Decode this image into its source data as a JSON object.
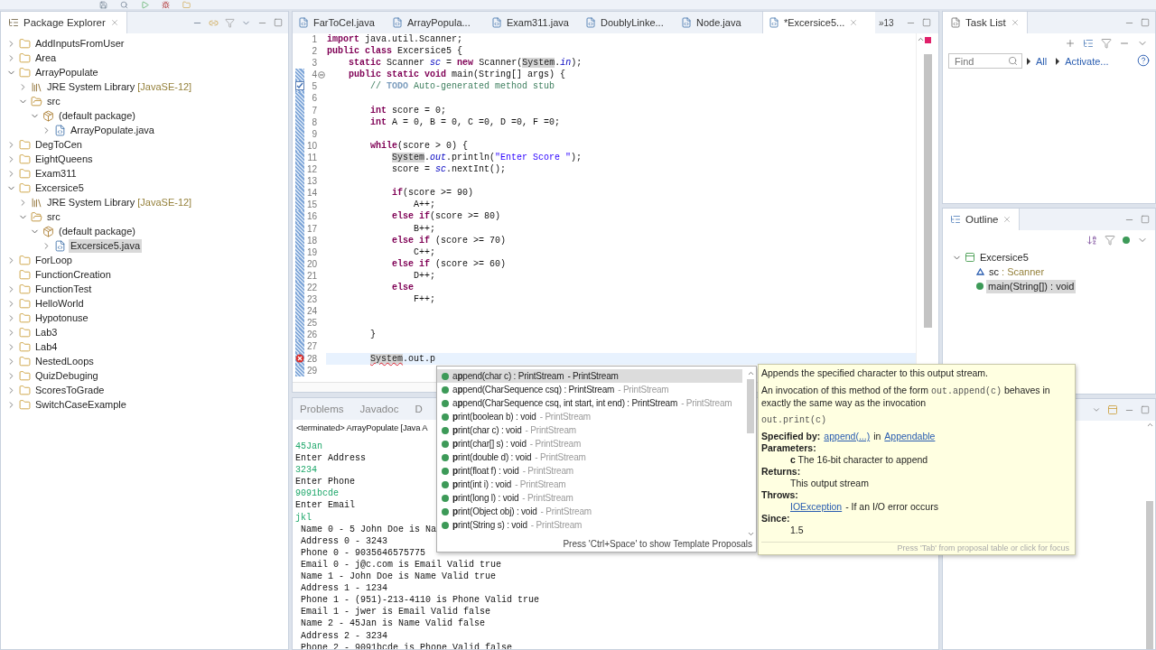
{
  "package_explorer": {
    "title": "Package Explorer",
    "items": [
      {
        "label": "AddInputsFromUser",
        "kind": "project",
        "expanded": false,
        "selected": false
      },
      {
        "label": "Area",
        "kind": "project",
        "expanded": false,
        "selected": false
      },
      {
        "label": "ArrayPopulate",
        "kind": "project",
        "expanded": true,
        "selected": false,
        "children": [
          {
            "label": "JRE System Library",
            "decoration": "[JavaSE-12]",
            "kind": "library",
            "expanded": false,
            "selected": false
          },
          {
            "label": "src",
            "kind": "src",
            "expanded": true,
            "selected": false,
            "children": [
              {
                "label": "(default package)",
                "kind": "package",
                "expanded": true,
                "selected": false,
                "children": [
                  {
                    "label": "ArrayPopulate.java",
                    "kind": "file",
                    "expanded": false,
                    "selected": false
                  }
                ]
              }
            ]
          }
        ]
      },
      {
        "label": "DegToCen",
        "kind": "project",
        "expanded": false,
        "selected": false
      },
      {
        "label": "EightQueens",
        "kind": "project",
        "expanded": false,
        "selected": false
      },
      {
        "label": "Exam311",
        "kind": "project",
        "expanded": false,
        "selected": false
      },
      {
        "label": "Excersice5",
        "kind": "project",
        "expanded": true,
        "selected": false,
        "children": [
          {
            "label": "JRE System Library",
            "decoration": "[JavaSE-12]",
            "kind": "library",
            "expanded": false,
            "selected": false
          },
          {
            "label": "src",
            "kind": "src",
            "expanded": true,
            "selected": false,
            "children": [
              {
                "label": "(default package)",
                "kind": "package",
                "expanded": true,
                "selected": false,
                "children": [
                  {
                    "label": "Excersice5.java",
                    "kind": "file",
                    "expanded": false,
                    "selected": true
                  }
                ]
              }
            ]
          }
        ]
      },
      {
        "label": "ForLoop",
        "kind": "project",
        "expanded": false,
        "selected": false
      },
      {
        "label": "FunctionCreation",
        "kind": "project",
        "selected": false
      },
      {
        "label": "FunctionTest",
        "kind": "project",
        "expanded": false,
        "selected": false
      },
      {
        "label": "HelloWorld",
        "kind": "project",
        "expanded": false,
        "selected": false
      },
      {
        "label": "Hypotonuse",
        "kind": "project",
        "expanded": false,
        "selected": false
      },
      {
        "label": "Lab3",
        "kind": "project",
        "expanded": false,
        "selected": false
      },
      {
        "label": "Lab4",
        "kind": "project",
        "expanded": false,
        "selected": false
      },
      {
        "label": "NestedLoops",
        "kind": "project",
        "expanded": false,
        "selected": false
      },
      {
        "label": "QuizDebuging",
        "kind": "project",
        "expanded": false,
        "selected": false
      },
      {
        "label": "ScoresToGrade",
        "kind": "project",
        "expanded": false,
        "selected": false
      },
      {
        "label": "SwitchCaseExample",
        "kind": "project",
        "expanded": false,
        "selected": false
      }
    ]
  },
  "editor_tabs": [
    {
      "label": "FarToCel.java",
      "selected": false
    },
    {
      "label": "ArrayPopula...",
      "selected": false
    },
    {
      "label": "Exam311.java",
      "selected": false
    },
    {
      "label": "DoublyLinke...",
      "selected": false
    },
    {
      "label": "Node.java",
      "selected": false
    },
    {
      "label": "*Excersice5...",
      "selected": true
    }
  ],
  "editor_overflow": "»13",
  "code_lines": [
    {
      "number": "1",
      "changed": false,
      "current": false,
      "segments": [
        {
          "text": "import",
          "kind": "keyword"
        },
        {
          "text": " java.util.Scanner;",
          "kind": "plain"
        }
      ]
    },
    {
      "number": "2",
      "changed": false,
      "current": false,
      "segments": [
        {
          "text": "public class",
          "kind": "keyword"
        },
        {
          "text": " Excersice5 {",
          "kind": "plain"
        }
      ]
    },
    {
      "number": "3",
      "changed": false,
      "current": false,
      "segments": [
        {
          "text": "    static",
          "kind": "keyword"
        },
        {
          "text": " Scanner ",
          "kind": "plain"
        },
        {
          "text": "sc",
          "kind": "field"
        },
        {
          "text": " = ",
          "kind": "plain"
        },
        {
          "text": "new",
          "kind": "keyword"
        },
        {
          "text": " Scanner(",
          "kind": "plain"
        },
        {
          "text": "System",
          "kind": "occurrence"
        },
        {
          "text": ".",
          "kind": "plain"
        },
        {
          "text": "in",
          "kind": "field"
        },
        {
          "text": ");",
          "kind": "plain"
        }
      ]
    },
    {
      "number": "4",
      "changed": true,
      "current": false,
      "fold": true,
      "segments": [
        {
          "text": "    public static void",
          "kind": "keyword"
        },
        {
          "text": " main(String[] args) {",
          "kind": "plain"
        }
      ]
    },
    {
      "number": "5",
      "changed": true,
      "current": false,
      "kind": "task",
      "segments": [
        {
          "text": "        // ",
          "kind": "comment"
        },
        {
          "text": "TODO",
          "kind": "todo"
        },
        {
          "text": " Auto-generated method stub",
          "kind": "comment"
        }
      ]
    },
    {
      "number": "6",
      "changed": true,
      "current": false
    },
    {
      "number": "7",
      "changed": true,
      "current": false,
      "segments": [
        {
          "text": "        int",
          "kind": "keyword"
        },
        {
          "text": " score = 0;",
          "kind": "plain"
        }
      ]
    },
    {
      "number": "8",
      "changed": true,
      "current": false,
      "segments": [
        {
          "text": "        int",
          "kind": "keyword"
        },
        {
          "text": " A = 0, B = 0, C =0, D =0, F =0;",
          "kind": "plain"
        }
      ]
    },
    {
      "number": "9",
      "changed": true,
      "current": false
    },
    {
      "number": "10",
      "changed": true,
      "current": false,
      "segments": [
        {
          "text": "        while",
          "kind": "keyword"
        },
        {
          "text": "(score > 0) {",
          "kind": "plain"
        }
      ]
    },
    {
      "number": "11",
      "changed": true,
      "current": false,
      "segments": [
        {
          "text": "            System",
          "kind": "occurrence"
        },
        {
          "text": ".",
          "kind": "plain"
        },
        {
          "text": "out",
          "kind": "field"
        },
        {
          "text": ".println(",
          "kind": "plain"
        },
        {
          "text": "\"Enter Score \"",
          "kind": "string"
        },
        {
          "text": ");",
          "kind": "plain"
        }
      ]
    },
    {
      "number": "12",
      "changed": true,
      "current": false,
      "segments": [
        {
          "text": "            score = ",
          "kind": "plain"
        },
        {
          "text": "sc",
          "kind": "field"
        },
        {
          "text": ".nextInt();",
          "kind": "plain"
        }
      ]
    },
    {
      "number": "13",
      "changed": true,
      "current": false
    },
    {
      "number": "14",
      "changed": true,
      "current": false,
      "segments": [
        {
          "text": "            if",
          "kind": "keyword"
        },
        {
          "text": "(score >= 90)",
          "kind": "plain"
        }
      ]
    },
    {
      "number": "15",
      "changed": true,
      "current": false,
      "segments": [
        {
          "text": "                A++;",
          "kind": "plain"
        }
      ]
    },
    {
      "number": "16",
      "changed": true,
      "current": false,
      "segments": [
        {
          "text": "            else if",
          "kind": "keyword"
        },
        {
          "text": "(score >= 80)",
          "kind": "plain"
        }
      ]
    },
    {
      "number": "17",
      "changed": true,
      "current": false,
      "segments": [
        {
          "text": "                B++;",
          "kind": "plain"
        }
      ]
    },
    {
      "number": "18",
      "changed": true,
      "current": false,
      "segments": [
        {
          "text": "            else if",
          "kind": "keyword"
        },
        {
          "text": " (score >= 70)",
          "kind": "plain"
        }
      ]
    },
    {
      "number": "19",
      "changed": true,
      "current": false,
      "segments": [
        {
          "text": "                C++;",
          "kind": "plain"
        }
      ]
    },
    {
      "number": "20",
      "changed": true,
      "current": false,
      "segments": [
        {
          "text": "            else if",
          "kind": "keyword"
        },
        {
          "text": " (score >= 60)",
          "kind": "plain"
        }
      ]
    },
    {
      "number": "21",
      "changed": true,
      "current": false,
      "segments": [
        {
          "text": "                D++;",
          "kind": "plain"
        }
      ]
    },
    {
      "number": "22",
      "changed": true,
      "current": false,
      "segments": [
        {
          "text": "            else",
          "kind": "keyword"
        }
      ]
    },
    {
      "number": "23",
      "changed": true,
      "current": false,
      "segments": [
        {
          "text": "                F++;",
          "kind": "plain"
        }
      ]
    },
    {
      "number": "24",
      "changed": true,
      "current": false
    },
    {
      "number": "25",
      "changed": true,
      "current": false
    },
    {
      "number": "26",
      "changed": true,
      "current": false,
      "segments": [
        {
          "text": "        }",
          "kind": "plain"
        }
      ]
    },
    {
      "number": "27",
      "changed": true,
      "current": false
    },
    {
      "number": "28",
      "changed": true,
      "current": true,
      "kind": "error",
      "segments": [
        {
          "text": "        System",
          "kind": "error"
        },
        {
          "text": ".out.p",
          "kind": "plain"
        }
      ]
    },
    {
      "number": "29",
      "changed": true,
      "current": false
    }
  ],
  "console": {
    "tabs": [
      {
        "label": "Problems",
        "selected": false
      },
      {
        "label": "Javadoc",
        "selected": false
      },
      {
        "label": "D",
        "selected": false
      }
    ],
    "status": "<terminated> ArrayPopulate [Java A",
    "lines": [
      {
        "text": "45Jan",
        "kind": "input"
      },
      {
        "text": "Enter Address",
        "kind": "output"
      },
      {
        "text": "3234",
        "kind": "input"
      },
      {
        "text": "Enter Phone",
        "kind": "output"
      },
      {
        "text": "9091bcde",
        "kind": "input"
      },
      {
        "text": "Enter Email",
        "kind": "output"
      },
      {
        "text": "jkl",
        "kind": "input"
      },
      {
        "text": "Name 0 - 5 John Doe is Na",
        "kind": "result"
      },
      {
        "text": "Address 0 - 3243",
        "kind": "result"
      },
      {
        "text": "Phone 0 - 9035646575775",
        "kind": "result"
      },
      {
        "text": "Email 0 - j@c.com is Email Valid true",
        "kind": "result"
      },
      {
        "text": "Name 1 - John Doe is Name Valid true",
        "kind": "result"
      },
      {
        "text": "Address 1 - 1234",
        "kind": "result"
      },
      {
        "text": "Phone 1 - (951)-213-4110 is Phone Valid true",
        "kind": "result"
      },
      {
        "text": "Email 1 - jwer is Email Valid false",
        "kind": "result"
      },
      {
        "text": "Name 2 - 45Jan is Name Valid false",
        "kind": "result"
      },
      {
        "text": "Address 2 - 3234",
        "kind": "result"
      },
      {
        "text": "Phone 2 - 9091bcde is Phone Valid false",
        "kind": "result"
      }
    ]
  },
  "task_list": {
    "title": "Task List",
    "find": {
      "placeholder": "Find"
    },
    "links": [
      "All",
      "Activate..."
    ]
  },
  "outline": {
    "title": "Outline",
    "items": [
      {
        "label": "Excersice5",
        "kind": "class",
        "expanded": true,
        "selected": false,
        "children": [
          {
            "label": "sc",
            "type": " : Scanner",
            "kind": "field",
            "selected": false
          },
          {
            "label": "main(String[]) : void",
            "kind": "method",
            "selected": true
          }
        ]
      }
    ]
  },
  "proposals": {
    "items": [
      {
        "label": "a**p**pend(char c) : PrintStream",
        "qualifier": "- PrintStream",
        "selected": true
      },
      {
        "label": "a**p**pend(CharSequence csq) : PrintStream",
        "qualifier": "- PrintStream",
        "selected": false
      },
      {
        "label": "a**p**pend(CharSequence csq, int start, int end) : PrintStream",
        "qualifier": "- PrintStream",
        "selected": false
      },
      {
        "label": "**p**rint(boolean b) : void",
        "qualifier": "- PrintStream",
        "selected": false
      },
      {
        "label": "**p**rint(char c) : void",
        "qualifier": "- PrintStream",
        "selected": false
      },
      {
        "label": "**p**rint(char[] s) : void",
        "qualifier": "- PrintStream",
        "selected": false
      },
      {
        "label": "**p**rint(double d) : void",
        "qualifier": "- PrintStream",
        "selected": false
      },
      {
        "label": "**p**rint(float f) : void",
        "qualifier": "- PrintStream",
        "selected": false
      },
      {
        "label": "**p**rint(int i) : void",
        "qualifier": "- PrintStream",
        "selected": false
      },
      {
        "label": "**p**rint(long l) : void",
        "qualifier": "- PrintStream",
        "selected": false
      },
      {
        "label": "**p**rint(Object obj) : void",
        "qualifier": "- PrintStream",
        "selected": false
      },
      {
        "label": "**p**rint(String s) : void",
        "qualifier": "- PrintStream",
        "selected": false
      }
    ],
    "hint": "Press 'Ctrl+Space' to show Template Proposals"
  },
  "javadoc": {
    "summary": "Appends the specified character to this output stream.",
    "invocation": {
      "before": "An invocation of this method of the form",
      "code": "out.append(c)",
      "after": "behaves in exactly the same way as the invocation"
    },
    "code_block": "out.print(c)",
    "specified_by": {
      "label": "Specified by:",
      "method_link": "append(...)",
      "joiner": "in",
      "type_link": "Appendable"
    },
    "parameters": {
      "label": "Parameters:",
      "text": "**c** The 16-bit character to append"
    },
    "returns": {
      "label": "Returns:",
      "text": "This output stream"
    },
    "throws": {
      "label": "Throws:",
      "link": "IOException",
      "text": "- If an I/O error occurs"
    },
    "since": {
      "label": "Since:",
      "text": "1.5"
    },
    "hint": "Press 'Tab' from proposal table or click for focus"
  }
}
